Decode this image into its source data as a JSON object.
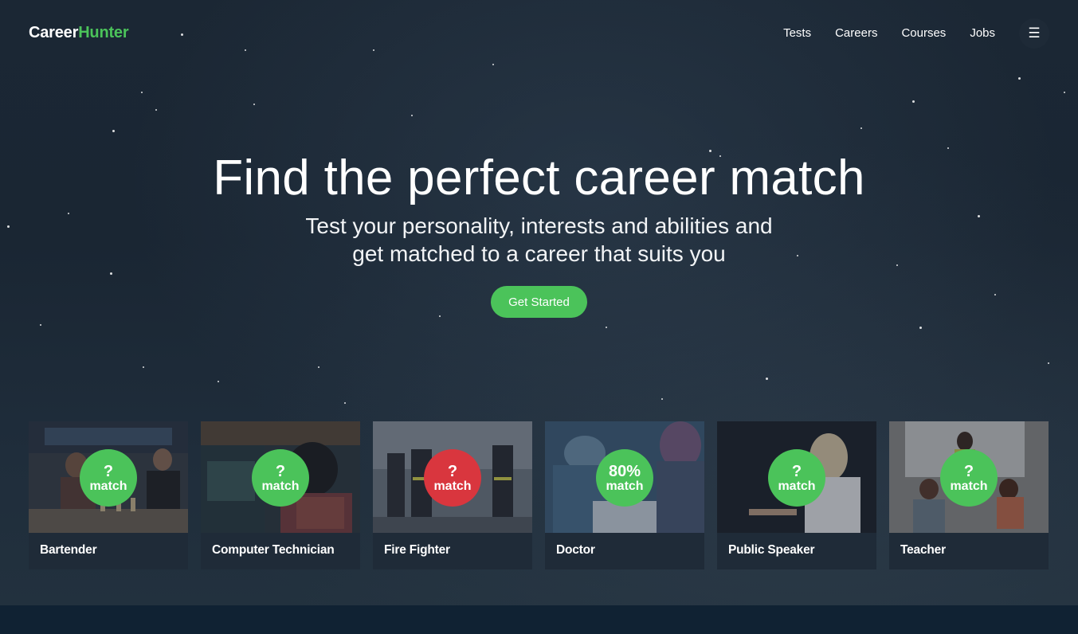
{
  "logo": {
    "part1": "Career",
    "part2": "Hunter"
  },
  "nav": [
    "Tests",
    "Careers",
    "Courses",
    "Jobs"
  ],
  "menu_icon": "hamburger-icon",
  "hero": {
    "title": "Find the perfect career match",
    "subtitle_line1": "Test your personality, interests and abilities and",
    "subtitle_line2": "get matched to a career that suits you",
    "cta": "Get Started"
  },
  "cards": [
    {
      "title": "Bartender",
      "match_value": "?",
      "match_label": "match",
      "badge_color": "#4bc35a"
    },
    {
      "title": "Computer Technician",
      "match_value": "?",
      "match_label": "match",
      "badge_color": "#4bc35a"
    },
    {
      "title": "Fire Fighter",
      "match_value": "?",
      "match_label": "match",
      "badge_color": "#d9363e"
    },
    {
      "title": "Doctor",
      "match_value": "80%",
      "match_label": "match",
      "badge_color": "#4bc35a"
    },
    {
      "title": "Public Speaker",
      "match_value": "?",
      "match_label": "match",
      "badge_color": "#4bc35a"
    },
    {
      "title": "Teacher",
      "match_value": "?",
      "match_label": "match",
      "badge_color": "#4bc35a"
    }
  ],
  "colors": {
    "accent": "#4bc35a",
    "danger": "#d9363e",
    "background": "#1b2734"
  }
}
